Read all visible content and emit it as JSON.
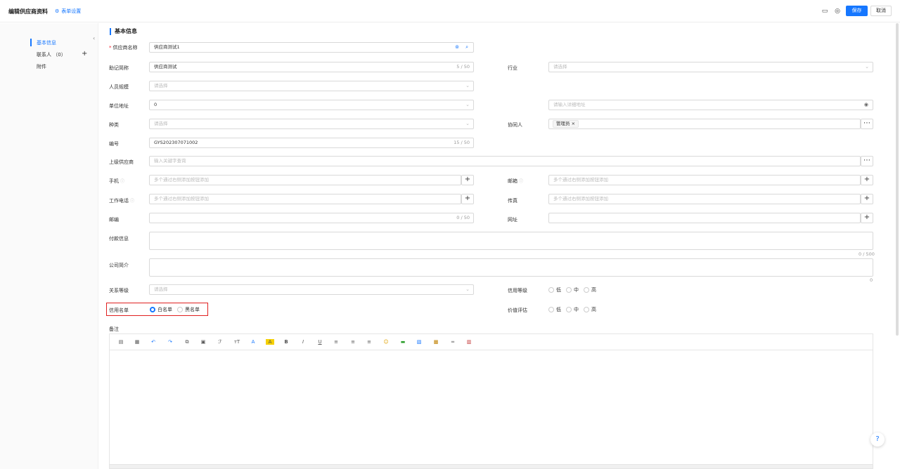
{
  "header": {
    "title": "编辑供应商资料",
    "form_settings": "表单设置",
    "save": "保存",
    "cancel": "取消"
  },
  "sidebar": {
    "items": [
      {
        "label": "基本信息"
      },
      {
        "label": "联系人",
        "count": "（0）"
      },
      {
        "label": "附件"
      }
    ]
  },
  "section_title": "基本信息",
  "fields": {
    "supplier_name": {
      "label": "供应商名称",
      "value": "供应商测试1"
    },
    "short_name": {
      "label": "助记简称",
      "value": "供应商测试",
      "count": "5 / 50"
    },
    "industry": {
      "label": "行业",
      "placeholder": "请选择"
    },
    "staff_size": {
      "label": "人员规模",
      "placeholder": "请选择"
    },
    "address": {
      "label": "单位地址",
      "value": "0",
      "detail_placeholder": "请输入详细地址"
    },
    "category": {
      "label": "种类",
      "placeholder": "请选择"
    },
    "collaborator": {
      "label": "协同人",
      "tag": "管理员"
    },
    "code": {
      "label": "编号",
      "value": "GYS202307071002",
      "count": "15 / 50"
    },
    "parent": {
      "label": "上级供应商",
      "placeholder": "输入关键字查询"
    },
    "mobile": {
      "label": "手机",
      "placeholder": "多个通过右侧添加按钮添加"
    },
    "email": {
      "label": "邮箱",
      "placeholder": "多个通过右侧添加按钮添加"
    },
    "work_phone": {
      "label": "工作电话",
      "placeholder": "多个通过右侧添加按钮添加"
    },
    "fax": {
      "label": "传真",
      "placeholder": "多个通过右侧添加按钮添加"
    },
    "postcode": {
      "label": "邮编",
      "count": "0 / 50"
    },
    "website": {
      "label": "网址"
    },
    "payment": {
      "label": "付款信息",
      "count": "0 / 500"
    },
    "intro": {
      "label": "公司简介",
      "count": "0"
    },
    "relation": {
      "label": "关系等级",
      "placeholder": "请选择"
    },
    "credit_level": {
      "label": "信用等级",
      "options": [
        "低",
        "中",
        "高"
      ]
    },
    "credit_list": {
      "label": "信用名单",
      "options": [
        "白名单",
        "黑名单"
      ],
      "selected": "白名单"
    },
    "value_eval": {
      "label": "价值评估",
      "options": [
        "低",
        "中",
        "高"
      ]
    },
    "remark": {
      "label": "备注"
    }
  },
  "colors": {
    "accent": "#1677ff",
    "highlight": "#e02020"
  },
  "editor_toolbar_icons": [
    "source-icon",
    "template-icon",
    "undo-icon",
    "redo-icon",
    "copy-icon",
    "paste-icon",
    "format-painter-icon",
    "font-size-icon",
    "font-color-icon",
    "highlight-color-icon",
    "bold-icon",
    "italic-icon",
    "underline-icon",
    "align-left-icon",
    "align-center-icon",
    "align-right-icon",
    "emoji-icon",
    "link-icon",
    "image-icon",
    "table-icon",
    "horizontal-line-icon",
    "code-icon"
  ]
}
